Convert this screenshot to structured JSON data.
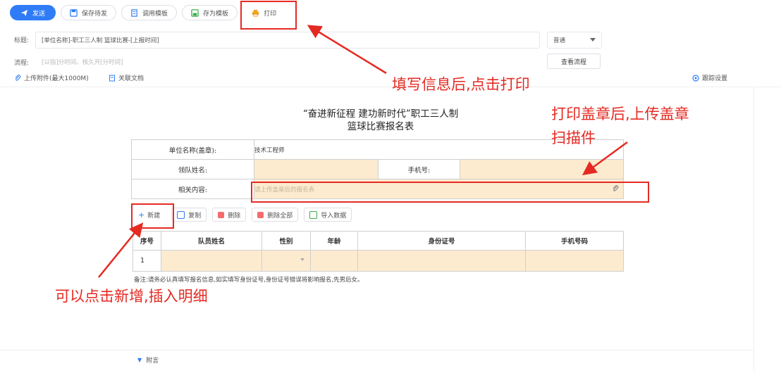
{
  "toolbar": {
    "send": "发送",
    "save_draft": "保存待发",
    "call_template": "调用模板",
    "save_as_template": "存为模板",
    "print": "打印"
  },
  "header": {
    "title_label": "标题:",
    "title_value": "[单位名称]-职工三人制 篮球比赛-[上报时间]",
    "priority_value": "普通",
    "process_label": "流程:",
    "process_placeholder": "[以指]分时间、核久开[分时间]",
    "view_process": "查看流程",
    "upload": "上传附件(最大1000M)",
    "related_doc": "关联文档",
    "follow_settings": "跟踪设置"
  },
  "document": {
    "title_line1": "“奋进新征程  建功新时代”职工三人制",
    "title_line2": "篮球比赛报名表",
    "unit_label": "单位名称(盖章):",
    "unit_value": "技术工程师",
    "leader_label": "领队姓名:",
    "phone_label": "手机号:",
    "content_label": "相关内容:",
    "content_placeholder": "请上传盖章后的报名表"
  },
  "detail_toolbar": {
    "add": "新建",
    "copy": "复制",
    "delete": "删除",
    "delete_all": "删除全部",
    "import": "导入数据"
  },
  "detail_table": {
    "headers": [
      "序号",
      "队员姓名",
      "性别",
      "年龄",
      "身份证号",
      "手机号码"
    ],
    "rows": [
      [
        "1",
        "",
        "",
        "",
        "",
        ""
      ]
    ]
  },
  "note": "备注:请务必认真填写报名信息,如实填写身份证号,身份证号错误将影响报名,先男后女。",
  "footer": {
    "attachment": "附言"
  },
  "annotations": {
    "print_hint": "填写信息后,点击打印",
    "upload_hint_line1": "打印盖章后,上传盖章",
    "upload_hint_line2": "扫描件",
    "add_hint": "可以点击新增,插入明细"
  },
  "colors": {
    "accent": "#2f7cf6",
    "annotation": "#e52a22",
    "fill": "#fdebd0"
  }
}
